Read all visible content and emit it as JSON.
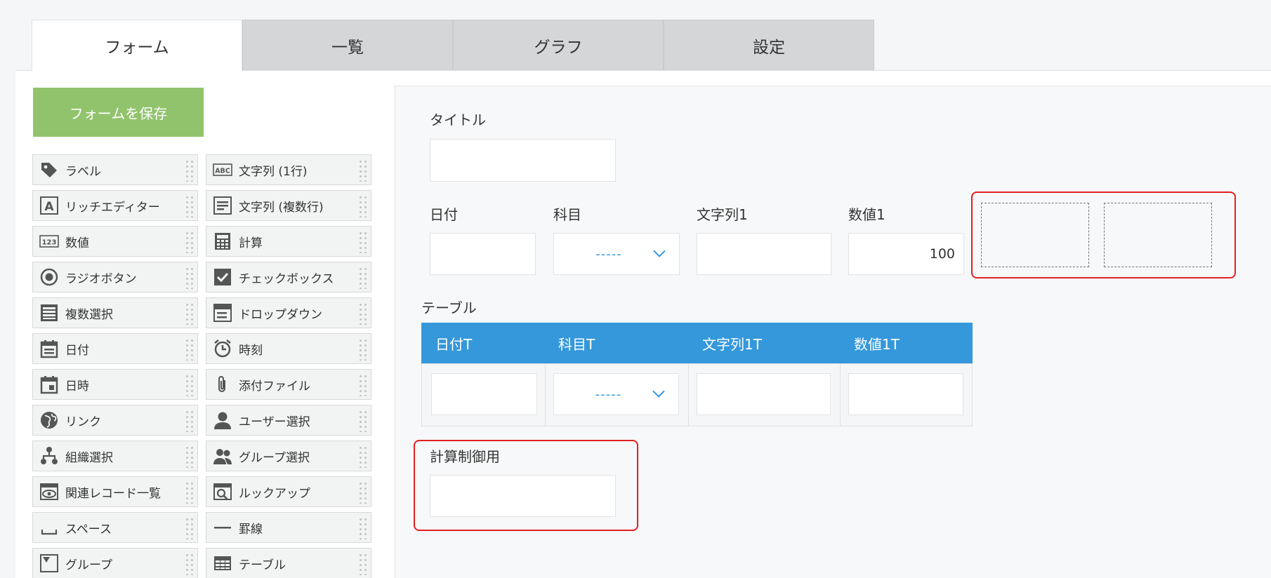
{
  "tabs": [
    {
      "label": "フォーム",
      "active": true
    },
    {
      "label": "一覧",
      "active": false
    },
    {
      "label": "グラフ",
      "active": false
    },
    {
      "label": "設定",
      "active": false
    }
  ],
  "save_button": {
    "label": "フォームを保存",
    "color": "#91c36c"
  },
  "palette": [
    {
      "label": "ラベル",
      "icon": "tag-icon"
    },
    {
      "label": "文字列 (1行)",
      "icon": "abc-text-icon"
    },
    {
      "label": "リッチエディター",
      "icon": "rich-editor-icon"
    },
    {
      "label": "文字列 (複数行)",
      "icon": "multiline-text-icon"
    },
    {
      "label": "数値",
      "icon": "number-123-icon"
    },
    {
      "label": "計算",
      "icon": "calculator-icon"
    },
    {
      "label": "ラジオボタン",
      "icon": "radio-button-icon"
    },
    {
      "label": "チェックボックス",
      "icon": "checkbox-icon"
    },
    {
      "label": "複数選択",
      "icon": "multi-select-icon"
    },
    {
      "label": "ドロップダウン",
      "icon": "dropdown-icon"
    },
    {
      "label": "日付",
      "icon": "date-icon"
    },
    {
      "label": "時刻",
      "icon": "clock-icon"
    },
    {
      "label": "日時",
      "icon": "datetime-icon"
    },
    {
      "label": "添付ファイル",
      "icon": "paperclip-icon"
    },
    {
      "label": "リンク",
      "icon": "globe-icon"
    },
    {
      "label": "ユーザー選択",
      "icon": "user-icon"
    },
    {
      "label": "組織選択",
      "icon": "org-chart-icon"
    },
    {
      "label": "グループ選択",
      "icon": "group-icon"
    },
    {
      "label": "関連レコード一覧",
      "icon": "related-records-icon"
    },
    {
      "label": "ルックアップ",
      "icon": "lookup-icon"
    },
    {
      "label": "スペース",
      "icon": "space-icon"
    },
    {
      "label": "罫線",
      "icon": "horizontal-line-icon"
    },
    {
      "label": "グループ",
      "icon": "group-field-icon"
    },
    {
      "label": "テーブル",
      "icon": "table-icon"
    }
  ],
  "form": {
    "title_label": "タイトル",
    "date_label": "日付",
    "subject_label": "科目",
    "subject_value": "-----",
    "string1_label": "文字列1",
    "number1_label": "数値1",
    "number1_value": "100",
    "table_label": "テーブル",
    "table_headers": [
      "日付T",
      "科目T",
      "文字列1T",
      "数値1T"
    ],
    "table_dropdown_value": "-----",
    "calc_label": "計算制御用"
  },
  "colors": {
    "accent": "#3498db",
    "highlight": "#e31f1f",
    "save": "#91c36c"
  }
}
